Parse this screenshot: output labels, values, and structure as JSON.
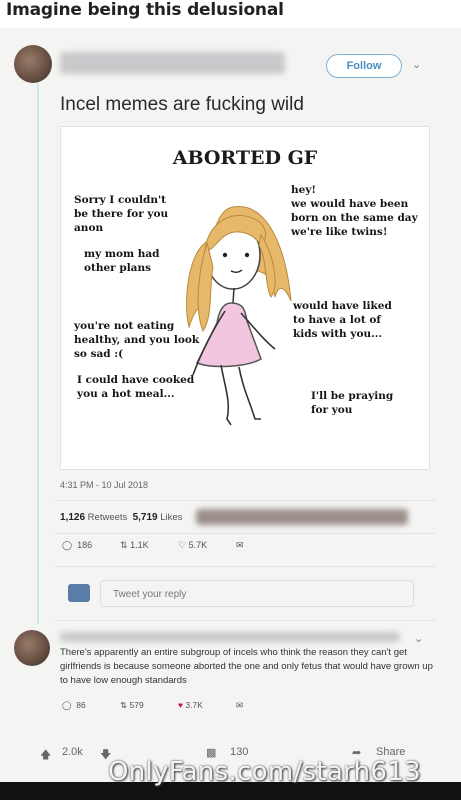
{
  "post_title": "Imagine being this delusional",
  "tweet": {
    "follow_label": "Follow",
    "text": "Incel memes are fucking wild",
    "timestamp": "4:31 PM - 10 Jul 2018",
    "retweets_count": "1,126",
    "retweets_label": "Retweets",
    "likes_count": "5,719",
    "likes_label": "Likes",
    "actions": {
      "replies": "186",
      "retweets": "1.1K",
      "likes": "5.7K"
    },
    "reply_placeholder": "Tweet your reply"
  },
  "meme": {
    "title": "ABORTED GF",
    "left_bubbles": [
      "Sorry I couldn't\nbe there for you\nanon",
      "my mom had\nother plans",
      "you're not eating\nhealthy, and you look\nso sad :(",
      "I could have cooked\nyou a hot meal..."
    ],
    "right_bubbles": [
      "hey!\nwe would have been\nborn on the same day\nwe're like twins!",
      "would have liked\nto have a lot of\nkids with you...",
      "I'll be praying\nfor you"
    ],
    "colors": {
      "hair": "#e8b86a",
      "dress": "#f2c6df"
    }
  },
  "reply": {
    "text": "There's apparently an entire subgroup of incels who think the reason they can't get girlfriends is because someone aborted the one and only fetus that would have grown up to have low enough standards",
    "actions": {
      "replies": "86",
      "retweets": "579",
      "likes": "3.7K"
    }
  },
  "reddit_bar": {
    "score": "2.0k",
    "comments": "130",
    "share_label": "Share"
  },
  "watermark": "OnlyFans.com/starh613"
}
